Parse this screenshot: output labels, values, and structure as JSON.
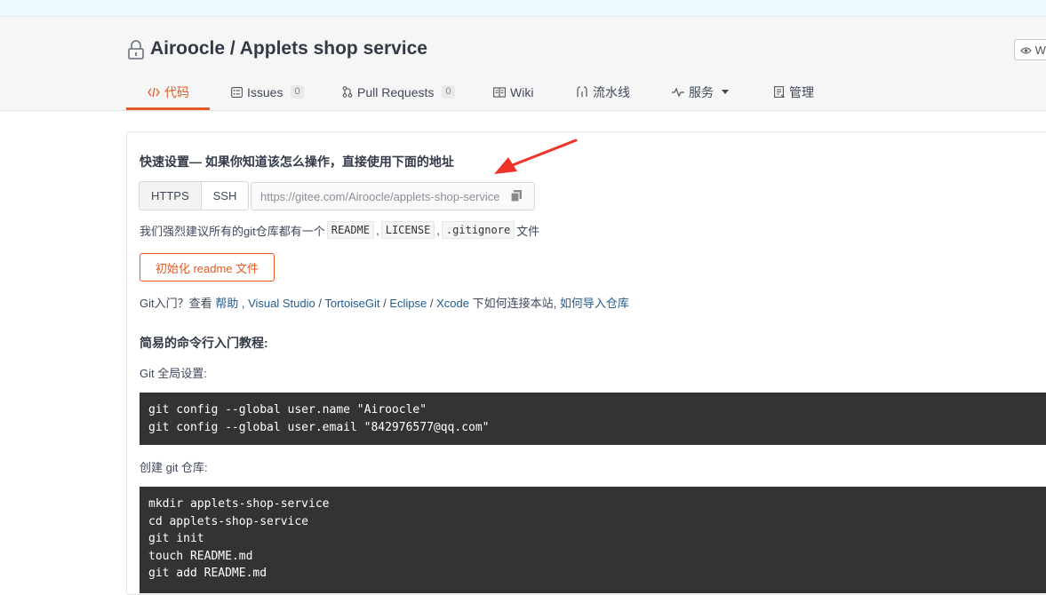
{
  "repo": {
    "title": "Airoocle / Applets shop service",
    "watch_label": "W"
  },
  "tabs": [
    {
      "label": "代码",
      "count": null
    },
    {
      "label": "Issues",
      "count": "0"
    },
    {
      "label": "Pull Requests",
      "count": "0"
    },
    {
      "label": "Wiki",
      "count": null
    },
    {
      "label": "流水线",
      "count": null
    },
    {
      "label": "服务",
      "count": null
    },
    {
      "label": "管理",
      "count": null
    }
  ],
  "setup": {
    "heading": "快速设置— 如果你知道该怎么操作，直接使用下面的地址",
    "https_label": "HTTPS",
    "ssh_label": "SSH",
    "url": "https://gitee.com/Airoocle/applets-shop-service.git",
    "recommend_prefix": "我们强烈建议所有的git仓库都有一个",
    "files": [
      "README",
      "LICENSE",
      ".gitignore"
    ],
    "sep": ",",
    "recommend_suffix": "文件",
    "init_button": "初始化 readme 文件"
  },
  "help": {
    "prefix": "Git入门？查看 ",
    "link_help": "帮助",
    "sep1": " , ",
    "link_vs": "Visual Studio",
    "slash1": " / ",
    "link_tortoise": "TortoiseGit",
    "slash2": " / ",
    "link_eclipse": "Eclipse",
    "slash3": " / ",
    "link_xcode": "Xcode",
    "middle": " 下如何连接本站, ",
    "link_import": "如何导入仓库"
  },
  "tutorial": {
    "heading": "简易的命令行入门教程:",
    "global_label": "Git 全局设置:",
    "global_code": [
      "git config --global user.name \"Airoocle\"",
      "git config --global user.email \"842976577@qq.com\""
    ],
    "create_label": "创建 git 仓库:",
    "create_code": [
      "mkdir applets-shop-service",
      "cd applets-shop-service",
      "git init",
      "touch README.md",
      "git add README.md"
    ]
  },
  "colors": {
    "accent": "#e45a25",
    "link": "#245c8f",
    "code_bg": "#333333",
    "arrow": "#f0332a"
  }
}
